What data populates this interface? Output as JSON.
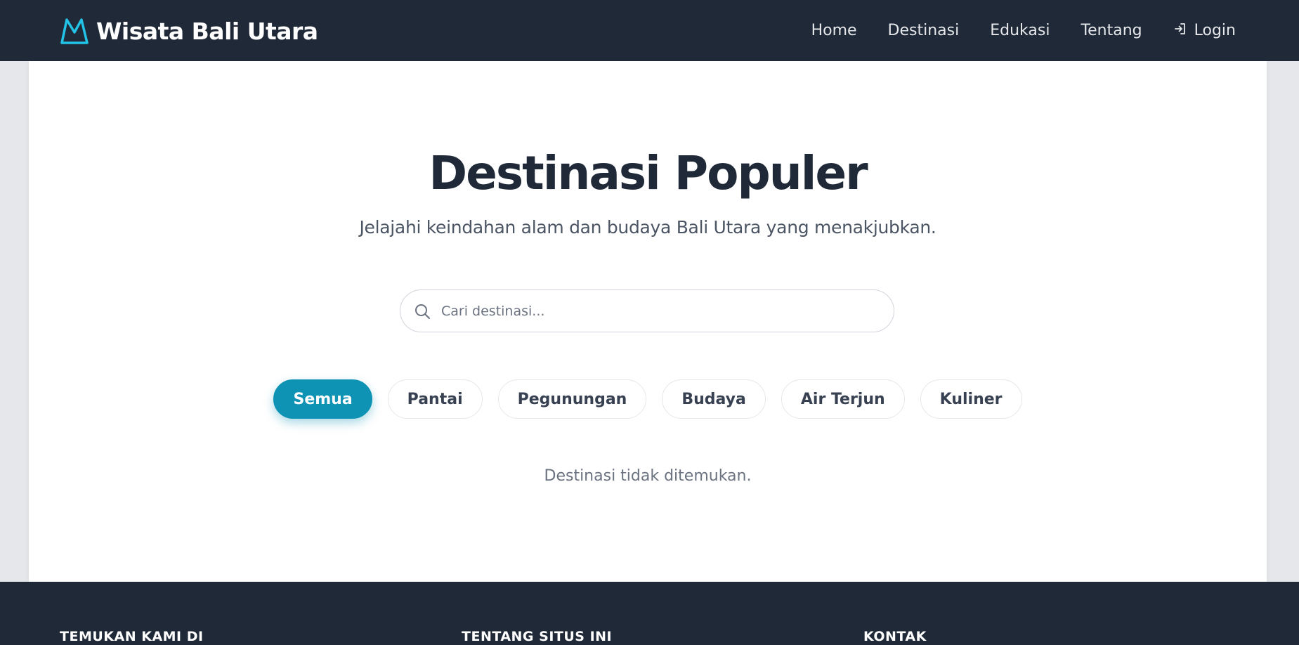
{
  "colors": {
    "nav_bg": "#1f2937",
    "accent": "#0e93b5",
    "logo_stroke": "#22c3e6",
    "title": "#1f2937",
    "page_bg": "#e5e7eb"
  },
  "navbar": {
    "brand": "Wisata Bali Utara",
    "logo_icon": "mountain-icon",
    "links": [
      "Home",
      "Destinasi",
      "Edukasi",
      "Tentang"
    ],
    "login_label": "Login",
    "login_icon": "login-arrow-icon"
  },
  "main": {
    "title": "Destinasi Populer",
    "subtitle": "Jelajahi keindahan alam dan budaya Bali Utara yang menakjubkan.",
    "search": {
      "placeholder": "Cari destinasi...",
      "icon": "search-icon",
      "value": ""
    },
    "filters": [
      "Semua",
      "Pantai",
      "Pegunungan",
      "Budaya",
      "Air Terjun",
      "Kuliner"
    ],
    "active_filter": "Semua",
    "empty_message": "Destinasi tidak ditemukan."
  },
  "footer": {
    "headings": [
      "TEMUKAN KAMI DI",
      "TENTANG SITUS INI",
      "KONTAK"
    ]
  }
}
